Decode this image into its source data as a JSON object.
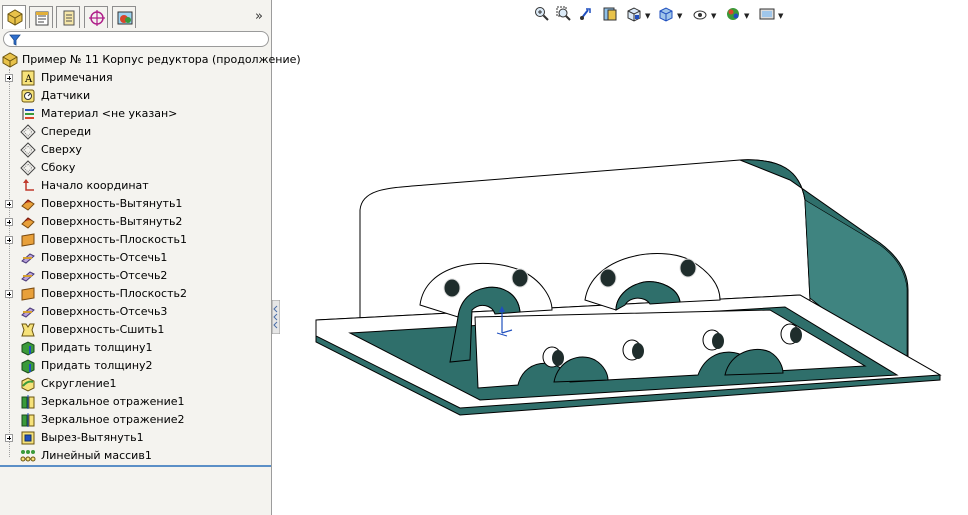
{
  "feature_manager": {
    "root": {
      "label": "Пример № 11 Корпус редуктора (продолжение)",
      "icon": "part-icon"
    },
    "items": [
      {
        "label": "Примечания",
        "icon": "annotations-icon",
        "expandable": true
      },
      {
        "label": "Датчики",
        "icon": "sensors-icon",
        "expandable": false
      },
      {
        "label": "Материал <не указан>",
        "icon": "material-icon",
        "expandable": false
      },
      {
        "label": "Спереди",
        "icon": "plane-icon",
        "expandable": false
      },
      {
        "label": "Сверху",
        "icon": "plane-icon",
        "expandable": false
      },
      {
        "label": "Сбоку",
        "icon": "plane-icon",
        "expandable": false
      },
      {
        "label": "Начало координат",
        "icon": "origin-icon",
        "expandable": false
      },
      {
        "label": "Поверхность-Вытянуть1",
        "icon": "surface-extrude-icon",
        "expandable": true
      },
      {
        "label": "Поверхность-Вытянуть2",
        "icon": "surface-extrude-icon",
        "expandable": true
      },
      {
        "label": "Поверхность-Плоскость1",
        "icon": "planar-surface-icon",
        "expandable": true
      },
      {
        "label": "Поверхность-Отсечь1",
        "icon": "surface-trim-icon",
        "expandable": false
      },
      {
        "label": "Поверхность-Отсечь2",
        "icon": "surface-trim-icon",
        "expandable": false
      },
      {
        "label": "Поверхность-Плоскость2",
        "icon": "planar-surface-icon",
        "expandable": true
      },
      {
        "label": "Поверхность-Отсечь3",
        "icon": "surface-trim-icon",
        "expandable": false
      },
      {
        "label": "Поверхность-Сшить1",
        "icon": "knit-icon",
        "expandable": false
      },
      {
        "label": "Придать толщину1",
        "icon": "thicken-icon",
        "expandable": false
      },
      {
        "label": "Придать толщину2",
        "icon": "thicken-icon",
        "expandable": false
      },
      {
        "label": "Скругление1",
        "icon": "fillet-icon",
        "expandable": false
      },
      {
        "label": "Зеркальное отражение1",
        "icon": "mirror-icon",
        "expandable": false
      },
      {
        "label": "Зеркальное отражение2",
        "icon": "mirror-icon",
        "expandable": false
      },
      {
        "label": "Вырез-Вытянуть1",
        "icon": "cut-extrude-icon",
        "expandable": true
      },
      {
        "label": "Линейный массив1",
        "icon": "linear-pattern-icon",
        "expandable": false
      }
    ]
  },
  "tabs": [
    "feature-manager-tab",
    "property-manager-tab",
    "configuration-manager-tab",
    "dimxpert-tab",
    "display-manager-tab"
  ],
  "colors": {
    "model_face": "#2f6f6b",
    "model_white": "#ffffff",
    "panel_bg": "#f4f3ef",
    "tree_separator": "#5b8fc7"
  }
}
